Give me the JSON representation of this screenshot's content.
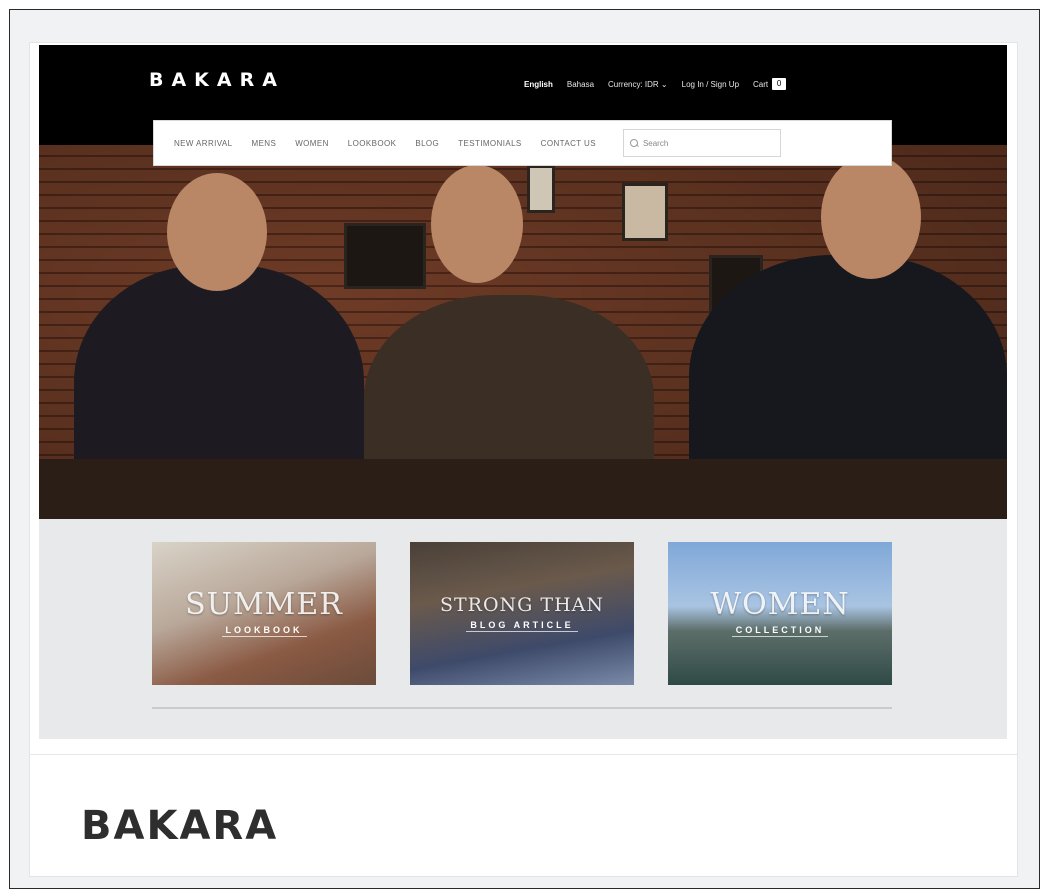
{
  "site": {
    "logo": "BAKARA",
    "top_links": {
      "lang_english": "English",
      "lang_bahasa": "Bahasa",
      "currency": "Currency: IDR ⌄",
      "auth": "Log In / Sign Up",
      "cart": "Cart",
      "cart_count": "0"
    },
    "nav": [
      "NEW ARRIVAL",
      "MENS",
      "WOMEN",
      "LOOKBOOK",
      "BLOG",
      "TESTIMONIALS",
      "CONTACT US"
    ],
    "search_placeholder": "Search",
    "tiles": [
      {
        "title": "SUMMER",
        "subtitle": "LOOKBOOK"
      },
      {
        "title": "STRONG THAN",
        "subtitle": "BLOG ARTICLE"
      },
      {
        "title": "WOMEN",
        "subtitle": "COLLECTION"
      }
    ]
  },
  "card": {
    "title": "BAKARA"
  },
  "colors": {
    "topbar": "#000000",
    "card_title": "#2e2e2e",
    "page_bg": "#f1f2f4"
  }
}
